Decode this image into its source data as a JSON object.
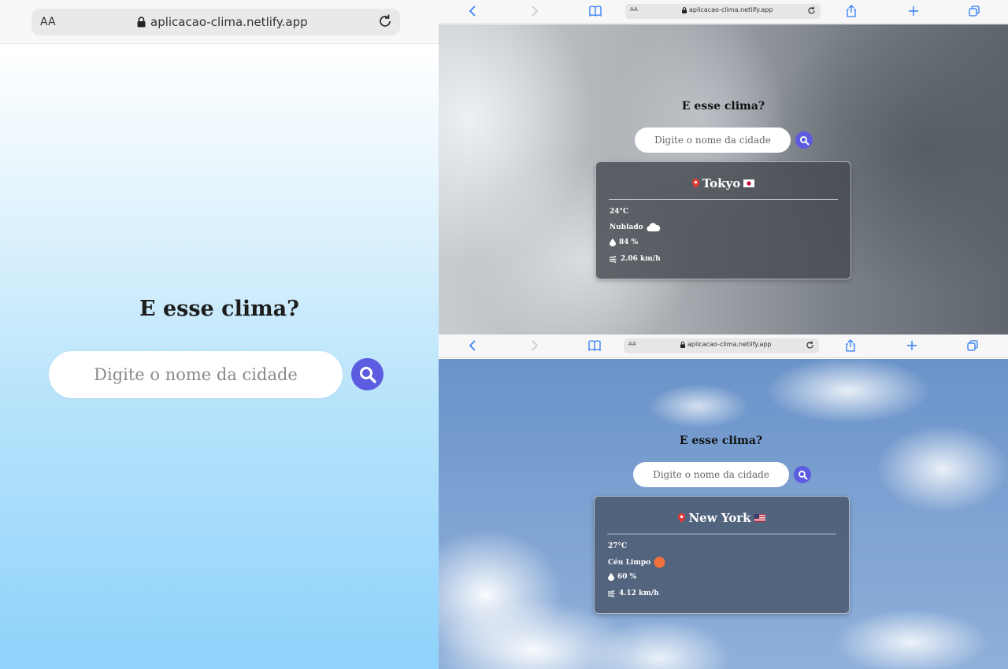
{
  "phone": {
    "aa": "AA",
    "url": "aplicacao-clima.netlify.app",
    "title": "E esse clima?",
    "placeholder": "Digite o nome da cidade"
  },
  "tablet_top": {
    "aa": "AA",
    "url": "aplicacao-clima.netlify.app",
    "title": "E esse clima?",
    "placeholder": "Digite o nome da cidade",
    "weather": {
      "city": "Tokyo",
      "temperature": "24°C",
      "description": "Nublado",
      "humidity": "84 %",
      "wind": "2.06 km/h",
      "flag": "japan-flag-icon",
      "condition_icon": "cloud-icon"
    }
  },
  "tablet_bottom": {
    "aa": "AA",
    "url": "aplicacao-clima.netlify.app",
    "title": "E esse clima?",
    "placeholder": "Digite o nome da cidade",
    "weather": {
      "city": "New York",
      "temperature": "27°C",
      "description": "Céu Limpo",
      "humidity": "60 %",
      "wind": "4.12 km/h",
      "flag": "usa-flag-icon",
      "condition_icon": "sun-icon"
    }
  },
  "colors": {
    "accent": "#5b5ce0",
    "pin": "#e53935",
    "sun": "#f2703b"
  }
}
